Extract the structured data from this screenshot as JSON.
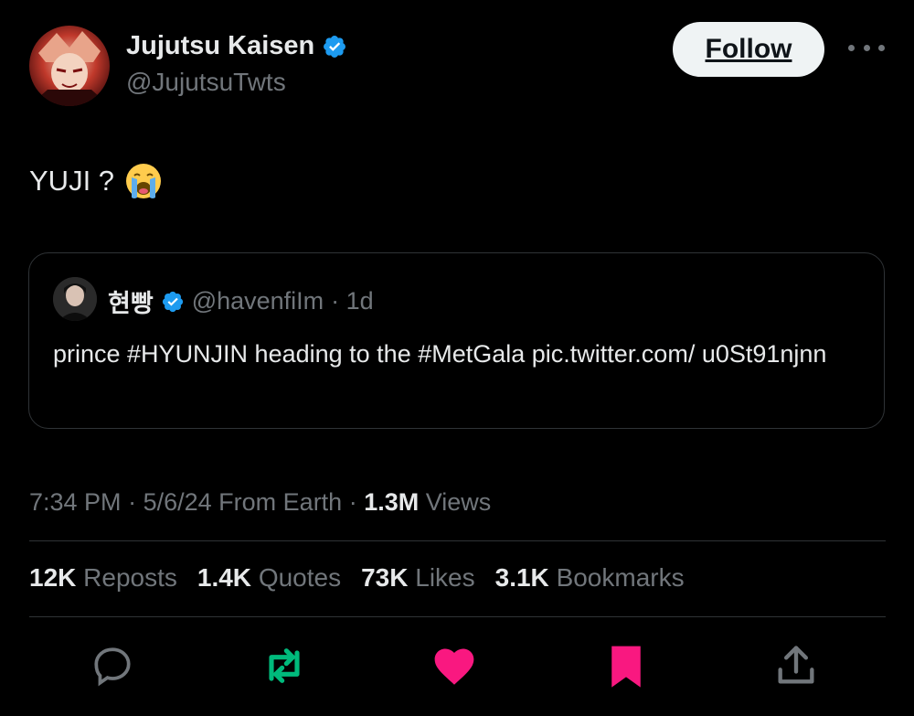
{
  "author": {
    "name": "Jujutsu Kaisen",
    "handle": "@JujutsuTwts",
    "verified": true,
    "follow_label": "Follow"
  },
  "tweet": {
    "text": "YUJI ?",
    "emoji": "loudly-crying-face-icon"
  },
  "quoted": {
    "name": "현빵",
    "handle": "@havenfiIm",
    "age": "· 1d",
    "text": "prince #HYUNJIN heading to the #MetGala pic.twitter.com/ u0St91njnn"
  },
  "meta": {
    "time": "7:34 PM",
    "date": "5/6/24",
    "source": "From Earth",
    "views_count": "1.3M",
    "views_label": "Views"
  },
  "stats": [
    {
      "count": "12K",
      "label": "Reposts"
    },
    {
      "count": "1.4K",
      "label": "Quotes"
    },
    {
      "count": "73K",
      "label": "Likes"
    },
    {
      "count": "3.1K",
      "label": "Bookmarks"
    }
  ],
  "colors": {
    "background": "#000000",
    "primary_text": "#e7e9ea",
    "secondary_text": "#71767b",
    "verified_blue": "#1d9bf0",
    "retweet_green": "#00ba7c",
    "like_pink": "#f91880",
    "divider": "#2f3336"
  },
  "actions": [
    "reply-icon",
    "repost-icon",
    "like-icon",
    "bookmark-icon",
    "share-icon"
  ]
}
